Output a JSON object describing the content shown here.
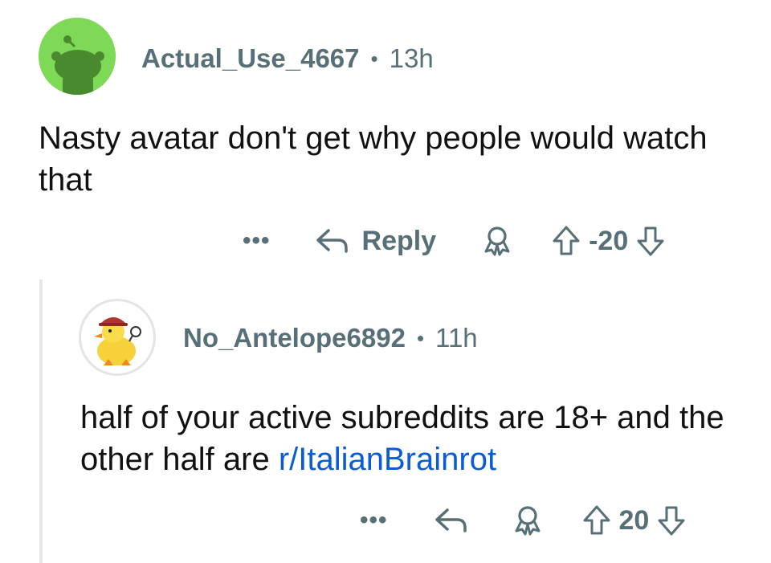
{
  "comment": {
    "username": "Actual_Use_4667",
    "separator": "•",
    "time": "13h",
    "body": "Nasty avatar don't get why people would watch that",
    "more_label": "•••",
    "reply_label": "Reply",
    "score": "-20"
  },
  "reply": {
    "username": "No_Antelope6892",
    "separator": "•",
    "time": "11h",
    "body_text": "half of your active subreddits are 18+ and the other half are ",
    "link_text": "r/ItalianBrainrot",
    "more_label": "•••",
    "score": "20"
  },
  "colors": {
    "meta_gray": "#576f76",
    "link_blue": "#0a5bd6",
    "avatar_green": "#7ed957"
  }
}
